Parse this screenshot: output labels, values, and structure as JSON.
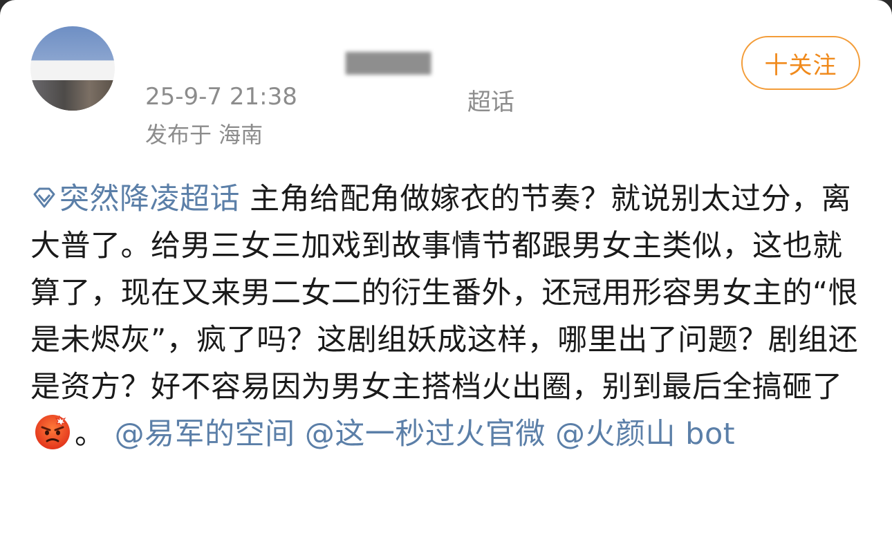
{
  "post": {
    "meta_time": "25-9-7 21:38",
    "meta_source_suffix": "超话",
    "location": "发布于 海南",
    "follow_label": "十关注",
    "topic": "突然降凌超话",
    "text_1": " 主角给配角做嫁衣的节奏？就说别太过分，离大普了。给男三女三加戏到故事情节都跟男女主类似，这也就算了，现在又来男二女二的衍生番外，还冠用形容男女主的“恨是未烬灰”，疯了吗？这剧组妖成这样，哪里出了问题？剧组还是资方？好不容易因为男女主搭档火出圈，别到最后全搞砸了",
    "text_2": "。",
    "mention_1": "@易军的空间",
    "mention_2": "@这一秒过火官微",
    "mention_3": "@火颜山 bot",
    "emoji_name": "angry-face-emoji"
  },
  "colors": {
    "link": "#5b7fa8",
    "follow": "#f08a1c",
    "meta": "#8c8c8c",
    "text": "#1a1a1a"
  }
}
